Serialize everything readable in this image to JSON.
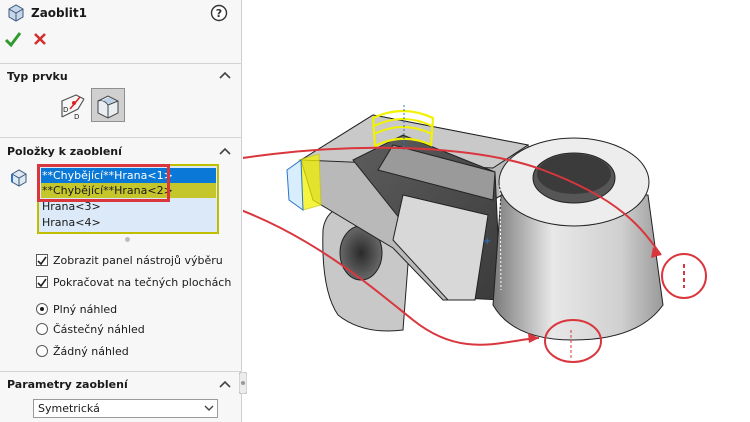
{
  "panel": {
    "title": "Zaoblit1",
    "ok_icon": "checkmark-icon",
    "cancel_icon": "close-icon",
    "help_icon": "help-icon",
    "sections": {
      "feature_type": {
        "title": "Typ prvku"
      },
      "items": {
        "title": "Položky k zaoblení",
        "list": [
          {
            "label": "**Chybějící**Hrana<1>",
            "state": "selected"
          },
          {
            "label": "**Chybějící**Hrana<2>",
            "state": "highlighted"
          },
          {
            "label": "Hrana<3>",
            "state": "normal"
          },
          {
            "label": "Hrana<4>",
            "state": "normal"
          }
        ],
        "checkboxes": [
          {
            "label": "Zobrazit panel nástrojů výběru",
            "checked": true
          },
          {
            "label": "Pokračovat na tečných plochách",
            "checked": true
          }
        ],
        "radios": [
          {
            "label": "Plný náhled",
            "checked": true
          },
          {
            "label": "Částečný náhled",
            "checked": false
          },
          {
            "label": "Žádný náhled",
            "checked": false
          }
        ]
      },
      "parameters": {
        "title": "Parametry zaoblení",
        "select_value": "Symetrická"
      }
    }
  },
  "colors": {
    "selected_bg": "#0a78d7",
    "highlight_bg": "#c5c52c",
    "annotation_red": "#d9363e",
    "preview_yellow": "#f2f200"
  }
}
